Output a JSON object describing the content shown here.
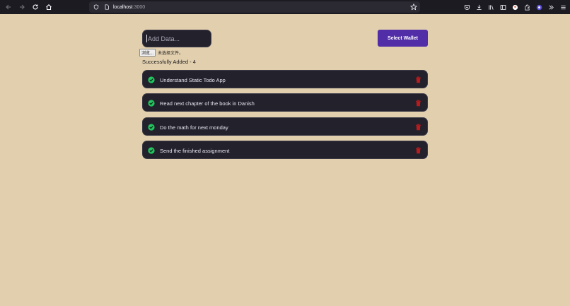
{
  "browser": {
    "url_host": "localhost",
    "url_port": ":3000"
  },
  "app": {
    "input_placeholder": "Add Data...",
    "wallet_button": "Select Wallet",
    "file_button": "浏览...",
    "file_status": "未选择文件。",
    "success_message": "Successfully Added - 4",
    "todos": [
      {
        "text": "Understand Static Todo App"
      },
      {
        "text": "Read next chapter of the book in Danish"
      },
      {
        "text": "Do the math for next monday"
      },
      {
        "text": "Send the finished assignment"
      }
    ]
  },
  "colors": {
    "background": "#e1cfae",
    "card": "#22212c",
    "accent": "#512da8",
    "check": "#22c55e",
    "trash": "#b91c1c"
  }
}
